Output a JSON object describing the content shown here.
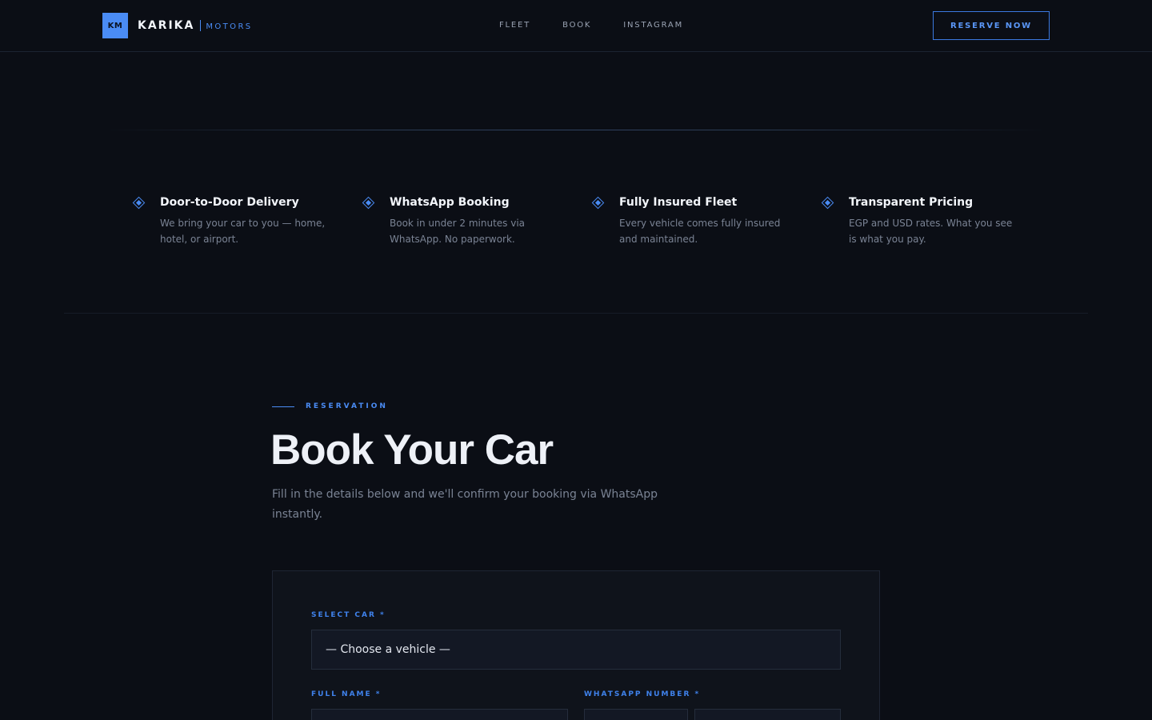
{
  "brand": {
    "mark": "KM",
    "name": "KARIKA",
    "sub": "MOTORS"
  },
  "nav": {
    "items": [
      "FLEET",
      "BOOK",
      "INSTAGRAM"
    ],
    "cta": "RESERVE NOW"
  },
  "features": [
    {
      "title": "Door-to-Door Delivery",
      "text": "We bring your car to you — home, hotel, or airport."
    },
    {
      "title": "WhatsApp Booking",
      "text": "Book in under 2 minutes via WhatsApp. No paperwork."
    },
    {
      "title": "Fully Insured Fleet",
      "text": "Every vehicle comes fully insured and maintained."
    },
    {
      "title": "Transparent Pricing",
      "text": "EGP and USD rates. What you see is what you pay."
    }
  ],
  "reservation": {
    "eyebrow": "RESERVATION",
    "title": "Book Your Car",
    "subtitle": "Fill in the details below and we'll confirm your booking via WhatsApp instantly.",
    "form": {
      "car_label": "SELECT CAR *",
      "car_value": "— Choose a vehicle —",
      "name_label": "FULL NAME *",
      "whatsapp_label": "WHATSAPP NUMBER *"
    }
  },
  "colors": {
    "background": "#0b0e15",
    "accent": "#4a8cf5",
    "text": "#eef1f7",
    "muted": "#7a8394"
  }
}
